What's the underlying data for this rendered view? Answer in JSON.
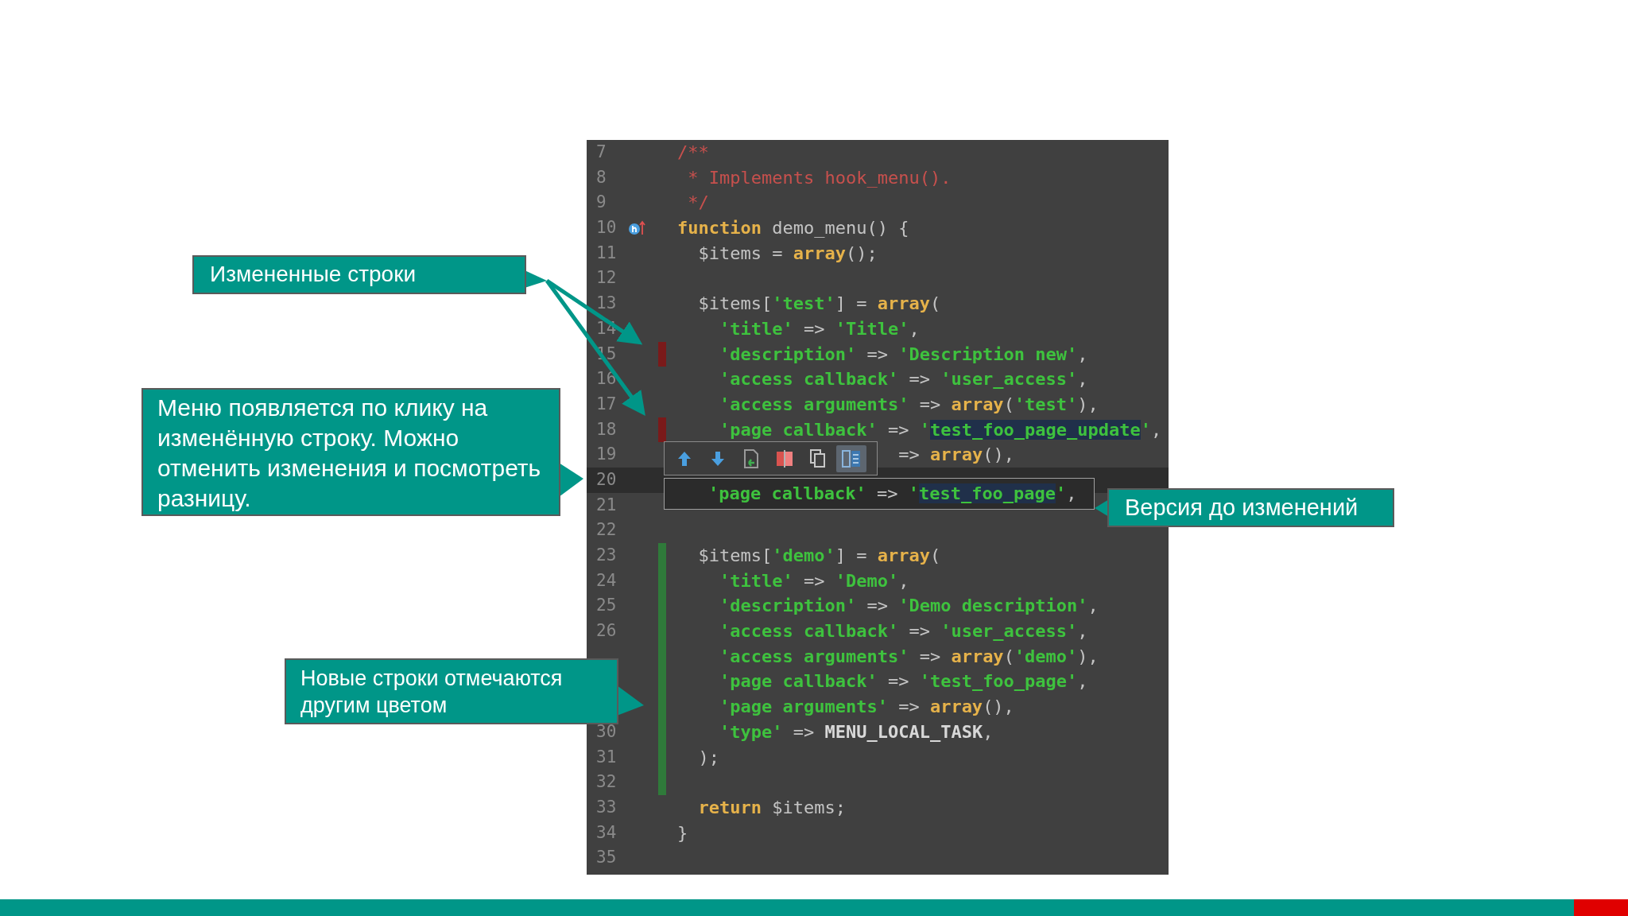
{
  "editor": {
    "lines": [
      {
        "number": "7",
        "modified": false,
        "added": false,
        "current": false,
        "tokens": [
          {
            "kind": "comment",
            "text": "/**"
          }
        ]
      },
      {
        "number": "8",
        "modified": false,
        "added": false,
        "current": false,
        "tokens": [
          {
            "kind": "comment",
            "text": " * Implements hook_menu()."
          }
        ]
      },
      {
        "number": "9",
        "modified": false,
        "added": false,
        "current": false,
        "tokens": [
          {
            "kind": "comment",
            "text": " */"
          }
        ]
      },
      {
        "number": "10",
        "modified": false,
        "added": false,
        "current": false,
        "gutter_icon": true,
        "tokens": [
          {
            "kind": "keyword",
            "text": "function"
          },
          {
            "kind": "plain",
            "text": " demo_menu() {"
          }
        ]
      },
      {
        "number": "11",
        "modified": false,
        "added": false,
        "current": false,
        "tokens": [
          {
            "kind": "plain",
            "text": "  $items = "
          },
          {
            "kind": "keyword",
            "text": "array"
          },
          {
            "kind": "plain",
            "text": "();"
          }
        ]
      },
      {
        "number": "12",
        "modified": false,
        "added": false,
        "current": false
      },
      {
        "number": "13",
        "modified": false,
        "added": false,
        "current": false,
        "tokens": [
          {
            "kind": "plain",
            "text": "  $items["
          },
          {
            "kind": "string",
            "text": "'test'"
          },
          {
            "kind": "plain",
            "text": "] = "
          },
          {
            "kind": "keyword",
            "text": "array"
          },
          {
            "kind": "plain",
            "text": "("
          }
        ]
      },
      {
        "number": "14",
        "modified": false,
        "added": false,
        "current": false,
        "tokens": [
          {
            "kind": "string",
            "text": "    'title'"
          },
          {
            "kind": "plain",
            "text": " => "
          },
          {
            "kind": "string",
            "text": "'Title'"
          },
          {
            "kind": "plain",
            "text": ","
          }
        ]
      },
      {
        "number": "15",
        "modified": true,
        "added": false,
        "current": false,
        "tokens": [
          {
            "kind": "string",
            "text": "    'description'"
          },
          {
            "kind": "plain",
            "text": " => "
          },
          {
            "kind": "string",
            "text": "'Description new'"
          },
          {
            "kind": "plain",
            "text": ","
          }
        ]
      },
      {
        "number": "16",
        "modified": false,
        "added": false,
        "current": false,
        "tokens": [
          {
            "kind": "string",
            "text": "    'access callback'"
          },
          {
            "kind": "plain",
            "text": " => "
          },
          {
            "kind": "string",
            "text": "'user_access'"
          },
          {
            "kind": "plain",
            "text": ","
          }
        ]
      },
      {
        "number": "17",
        "modified": false,
        "added": false,
        "current": false,
        "tokens": [
          {
            "kind": "string",
            "text": "    'access arguments'"
          },
          {
            "kind": "plain",
            "text": " => "
          },
          {
            "kind": "keyword",
            "text": "array"
          },
          {
            "kind": "plain",
            "text": "("
          },
          {
            "kind": "string",
            "text": "'test'"
          },
          {
            "kind": "plain",
            "text": "),"
          }
        ]
      },
      {
        "number": "18",
        "modified": true,
        "added": false,
        "current": false,
        "tokens": [
          {
            "kind": "string",
            "text": "    'page callback'"
          },
          {
            "kind": "plain",
            "text": " => "
          },
          {
            "kind": "string",
            "text": "'"
          },
          {
            "kind": "match",
            "text": "test_foo_page_update"
          },
          {
            "kind": "string",
            "text": "'"
          },
          {
            "kind": "plain",
            "text": ","
          }
        ]
      },
      {
        "number": "19",
        "modified": false,
        "added": false,
        "current": false,
        "tokens": [
          {
            "kind": "plain",
            "text": "                     => "
          },
          {
            "kind": "keyword",
            "text": "array"
          },
          {
            "kind": "plain",
            "text": "(),"
          }
        ]
      },
      {
        "number": "20",
        "modified": false,
        "added": false,
        "current": true
      },
      {
        "number": "21",
        "modified": false,
        "added": false,
        "current": false
      },
      {
        "number": "22",
        "modified": false,
        "added": false,
        "current": false
      },
      {
        "number": "23",
        "modified": false,
        "added": true,
        "current": false,
        "tokens": [
          {
            "kind": "plain",
            "text": "  $items["
          },
          {
            "kind": "string",
            "text": "'demo'"
          },
          {
            "kind": "plain",
            "text": "] = "
          },
          {
            "kind": "keyword",
            "text": "array"
          },
          {
            "kind": "plain",
            "text": "("
          }
        ]
      },
      {
        "number": "24",
        "modified": false,
        "added": true,
        "current": false,
        "tokens": [
          {
            "kind": "string",
            "text": "    'title'"
          },
          {
            "kind": "plain",
            "text": " => "
          },
          {
            "kind": "string",
            "text": "'Demo'"
          },
          {
            "kind": "plain",
            "text": ","
          }
        ]
      },
      {
        "number": "25",
        "modified": false,
        "added": true,
        "current": false,
        "tokens": [
          {
            "kind": "string",
            "text": "    'description'"
          },
          {
            "kind": "plain",
            "text": " => "
          },
          {
            "kind": "string",
            "text": "'Demo description'"
          },
          {
            "kind": "plain",
            "text": ","
          }
        ]
      },
      {
        "number": "26",
        "modified": false,
        "added": true,
        "current": false,
        "tokens": [
          {
            "kind": "string",
            "text": "    'access callback'"
          },
          {
            "kind": "plain",
            "text": " => "
          },
          {
            "kind": "string",
            "text": "'user_access'"
          },
          {
            "kind": "plain",
            "text": ","
          }
        ]
      },
      {
        "modified": false,
        "added": true,
        "current": false,
        "tokens": [
          {
            "kind": "string",
            "text": "    'access arguments'"
          },
          {
            "kind": "plain",
            "text": " => "
          },
          {
            "kind": "keyword",
            "text": "array"
          },
          {
            "kind": "plain",
            "text": "("
          },
          {
            "kind": "string",
            "text": "'demo'"
          },
          {
            "kind": "plain",
            "text": "),"
          }
        ]
      },
      {
        "modified": false,
        "added": true,
        "current": false,
        "tokens": [
          {
            "kind": "string",
            "text": "    'page callback'"
          },
          {
            "kind": "plain",
            "text": " => "
          },
          {
            "kind": "string",
            "text": "'test_foo_page'"
          },
          {
            "kind": "plain",
            "text": ","
          }
        ]
      },
      {
        "modified": false,
        "added": true,
        "current": false,
        "tokens": [
          {
            "kind": "string",
            "text": "    'page arguments'"
          },
          {
            "kind": "plain",
            "text": " => "
          },
          {
            "kind": "keyword",
            "text": "array"
          },
          {
            "kind": "plain",
            "text": "(),"
          }
        ]
      },
      {
        "number": "30",
        "modified": false,
        "added": true,
        "current": false,
        "tokens": [
          {
            "kind": "string",
            "text": "    'type'"
          },
          {
            "kind": "plain",
            "text": " => "
          },
          {
            "kind": "constant",
            "text": "MENU_LOCAL_TASK"
          },
          {
            "kind": "plain",
            "text": ","
          }
        ]
      },
      {
        "number": "31",
        "modified": false,
        "added": true,
        "current": false,
        "tokens": [
          {
            "kind": "plain",
            "text": "  );"
          }
        ]
      },
      {
        "number": "32",
        "modified": false,
        "added": true,
        "current": false
      },
      {
        "number": "33",
        "modified": false,
        "added": false,
        "current": false,
        "tokens": [
          {
            "kind": "keyword",
            "text": "  return"
          },
          {
            "kind": "plain",
            "text": " $items;"
          }
        ]
      },
      {
        "number": "34",
        "modified": false,
        "added": false,
        "current": false,
        "tokens": [
          {
            "kind": "plain",
            "text": "}"
          }
        ]
      },
      {
        "number": "35",
        "modified": false,
        "added": false,
        "current": false
      }
    ],
    "change_toolbar": [
      {
        "kind": "previous",
        "selected": false
      },
      {
        "kind": "next",
        "selected": false
      },
      {
        "kind": "revert",
        "selected": false
      },
      {
        "kind": "diff",
        "selected": false
      },
      {
        "kind": "copy",
        "selected": false
      },
      {
        "kind": "highlight",
        "selected": true
      }
    ],
    "diff_popup": {
      "tokens": [
        {
          "kind": "string",
          "text": "    'page callback'"
        },
        {
          "kind": "plain",
          "text": " => "
        },
        {
          "kind": "string",
          "text": "'"
        },
        {
          "kind": "match",
          "text": "test_foo_page"
        },
        {
          "kind": "string",
          "text": "'"
        },
        {
          "kind": "plain",
          "text": ","
        }
      ]
    }
  },
  "callouts": [
    {
      "kind": "changed",
      "text": "Измененные строки"
    },
    {
      "kind": "menu",
      "text": "Меню появляется по клику на изменённую строку. Можно отменить изменения и посмотреть разницу."
    },
    {
      "kind": "before",
      "text": "Версия до изменений"
    },
    {
      "kind": "added",
      "text": "Новые строки отмечаются другим цветом"
    }
  ]
}
